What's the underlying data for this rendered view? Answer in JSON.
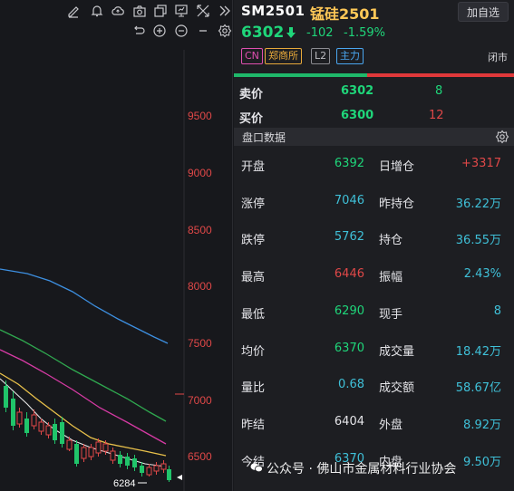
{
  "toolbar": {
    "top_icons": [
      "edit-icon",
      "bell-icon",
      "cloud-icon",
      "camera-icon",
      "copy-icon",
      "present-icon",
      "fullscreen-icon",
      "collapse-right-icon"
    ],
    "second_icons": [
      "undo-icon",
      "zoom-in-icon",
      "zoom-out-icon",
      "settings-icon"
    ]
  },
  "chart": {
    "price_axis": [
      "9500",
      "9000",
      "8500",
      "8000",
      "7500",
      "7000",
      "6500"
    ],
    "low_marker": "6284",
    "colors": {
      "ma_blue": "#3d8fe0",
      "ma_green": "#2fa84f",
      "ma_magenta": "#d63aa4",
      "ma_yellow": "#e8c04a",
      "down": "#20c46a",
      "up": "#e04848",
      "axis_text": "#e04848"
    }
  },
  "header": {
    "symbol": "SM2501",
    "name": "锰硅2501",
    "add_button": "加自选",
    "last_price": "6302",
    "change": "-102",
    "change_pct": "-1.59%",
    "tags": [
      "CN",
      "郑商所",
      "L2",
      "主力"
    ],
    "status": "闭市"
  },
  "orderbook": {
    "ask_label": "卖价",
    "ask_price": "6302",
    "ask_vol": "8",
    "bid_label": "买价",
    "bid_price": "6300",
    "bid_vol": "12"
  },
  "panel": {
    "title": "盘口数据",
    "stats_left": [
      {
        "label": "开盘",
        "value": "6392",
        "color": "#1fd67a"
      },
      {
        "label": "涨停",
        "value": "7046",
        "color": "#3fc0d8"
      },
      {
        "label": "跌停",
        "value": "5762",
        "color": "#3fc0d8"
      },
      {
        "label": "最高",
        "value": "6446",
        "color": "#e04848"
      },
      {
        "label": "最低",
        "value": "6290",
        "color": "#1fd67a"
      },
      {
        "label": "均价",
        "value": "6370",
        "color": "#1fd67a"
      },
      {
        "label": "量比",
        "value": "0.68",
        "color": "#3fc0d8"
      },
      {
        "label": "昨结",
        "value": "6404",
        "color": "#e4e4e8"
      },
      {
        "label": "今结",
        "value": "6370",
        "color": "#3fc0d8"
      }
    ],
    "stats_right": [
      {
        "label": "日增仓",
        "value": "+3317",
        "color": "#e04848"
      },
      {
        "label": "昨持仓",
        "value": "36.22万",
        "color": "#3fc0d8"
      },
      {
        "label": "持仓",
        "value": "36.55万",
        "color": "#3fc0d8"
      },
      {
        "label": "振幅",
        "value": "2.43%",
        "color": "#3fc0d8"
      },
      {
        "label": "现手",
        "value": "8",
        "color": "#3fc0d8"
      },
      {
        "label": "成交量",
        "value": "18.42万",
        "color": "#3fc0d8"
      },
      {
        "label": "成交额",
        "value": "58.67亿",
        "color": "#3fc0d8"
      },
      {
        "label": "外盘",
        "value": "8.92万",
        "color": "#3fc0d8"
      },
      {
        "label": "内盘",
        "value": "9.50万",
        "color": "#3fc0d8"
      }
    ]
  },
  "watermark": "公众号 · 佛山市金属材料行业协会"
}
